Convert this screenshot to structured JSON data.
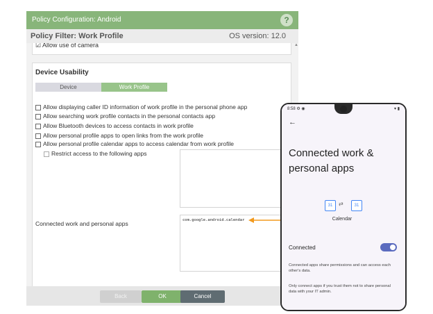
{
  "dialog": {
    "title": "Policy Configuration: Android",
    "help_glyph": "?",
    "filter_label": "Policy Filter: Work Profile",
    "os_version": "OS version: 12.0"
  },
  "camera": {
    "checkbox": "☑",
    "label": "Allow use of camera",
    "checked": true
  },
  "usability": {
    "heading": "Device Usability",
    "segments": [
      "Device",
      "Work Profile"
    ],
    "selected_segment": "Work Profile",
    "options": [
      "Allow displaying caller ID information of work profile in the personal phone app",
      "Allow searching work profile contacts in the personal contacts app",
      "Allow Bluetooth devices to access contacts in work profile",
      "Allow personal profile apps to open links from the work profile",
      "Allow personal profile calendar apps to access calendar from work profile"
    ],
    "sub_option": "Restrict access to the following apps",
    "connected_label": "Connected work and personal apps",
    "connected_value": "com.google.android.calendar"
  },
  "footer": {
    "back": "Back",
    "ok": "OK",
    "cancel": "Cancel"
  },
  "phone": {
    "time": "8:58",
    "status_icons": "⚙ ◉",
    "status_right": "▾ ▮",
    "back_glyph": "←",
    "title": "Connected work & personal apps",
    "app_name": "Calendar",
    "calendar_badge": "31",
    "swap_glyph": "⇄",
    "connected_label": "Connected",
    "connected_on": true,
    "desc1": "Connected apps share permissions and can access each other's data.",
    "desc2": "Only connect apps if you trust them not to share personal data with your IT admin."
  },
  "colors": {
    "accent_green": "#88b57a",
    "ok_green": "#7fb26c",
    "cancel_gray": "#5f6c72",
    "arrow_orange": "#f29a1e",
    "toggle_blue": "#5b6bbf"
  }
}
